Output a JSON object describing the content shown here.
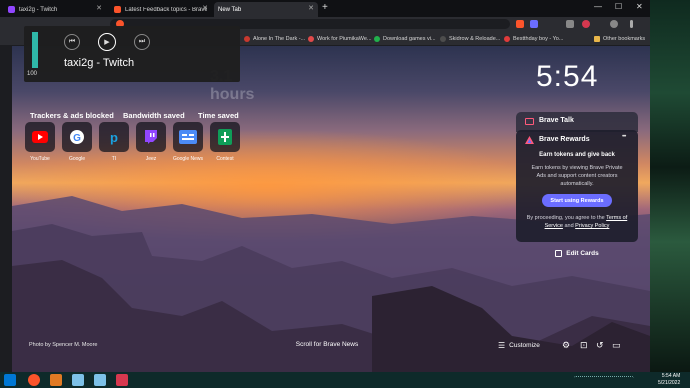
{
  "tabs": [
    {
      "title": "taxi2g - Twitch",
      "active": false
    },
    {
      "title": "Latest Feedback topics - Brave Comm",
      "active": false
    },
    {
      "title": "New Tab",
      "active": true
    }
  ],
  "window_controls": {
    "minimize": "—",
    "maximize": "☐",
    "close": "✕"
  },
  "bookmarks": [
    {
      "label": "Alone In The Dark -...",
      "color": "#c8392f"
    },
    {
      "label": "Work for PiumikaWe...",
      "color": "#e04a4a"
    },
    {
      "label": "Download games vi...",
      "color": "#22b14c"
    },
    {
      "label": "Skidrow & Reloade...",
      "color": "#4d4d4d"
    },
    {
      "label": "Bestthday boy - Yo...",
      "color": "#e03b3b"
    },
    {
      "label": "Other bookmarks",
      "color": "#e8b64a"
    }
  ],
  "stats": [
    {
      "label": "Trackers & ads blocked"
    },
    {
      "label": "Bandwidth saved"
    },
    {
      "label": "Time saved",
      "value": "3.1 hours"
    }
  ],
  "clock": "5:54",
  "top_sites": [
    {
      "label": "YouTube",
      "icon": "youtube-icon",
      "color": "#ff0000"
    },
    {
      "label": "Google",
      "icon": "google-icon",
      "color": "#4285f4"
    },
    {
      "label": "TI",
      "icon": "tp-icon",
      "color": "#1aa1e0"
    },
    {
      "label": "Jeez",
      "icon": "twitch-icon",
      "color": "#9146ff"
    },
    {
      "label": "Google News",
      "icon": "google-news-icon",
      "color": "#4c8bf5"
    },
    {
      "label": "Contest",
      "icon": "sheets-icon",
      "color": "#0f9d58"
    }
  ],
  "brave_talk": {
    "title": "Brave Talk"
  },
  "rewards": {
    "title": "Brave Rewards",
    "subtitle": "Earn tokens and give back",
    "body": "Earn tokens by viewing Brave Private Ads and support content creators automatically.",
    "button": "Start using Rewards",
    "terms_prefix": "By proceeding, you agree to the",
    "terms_link": "Terms of Service",
    "terms_and": "and",
    "privacy_link": "Privacy Policy",
    "menu": "•••"
  },
  "edit_cards": "Edit Cards",
  "photo_credit": "Photo by Spencer M. Moore",
  "scroll_news": "Scroll for Brave News",
  "customize": "Customize",
  "media": {
    "title": "taxi2g - Twitch",
    "volume": "100",
    "volume_level": 1.0
  },
  "desktop": {
    "left_label": "DD",
    "side_label_a": "A",
    "side_label_b": "A"
  },
  "taskbar": {
    "time": "5:54 AM",
    "date": "5/21/2022"
  }
}
